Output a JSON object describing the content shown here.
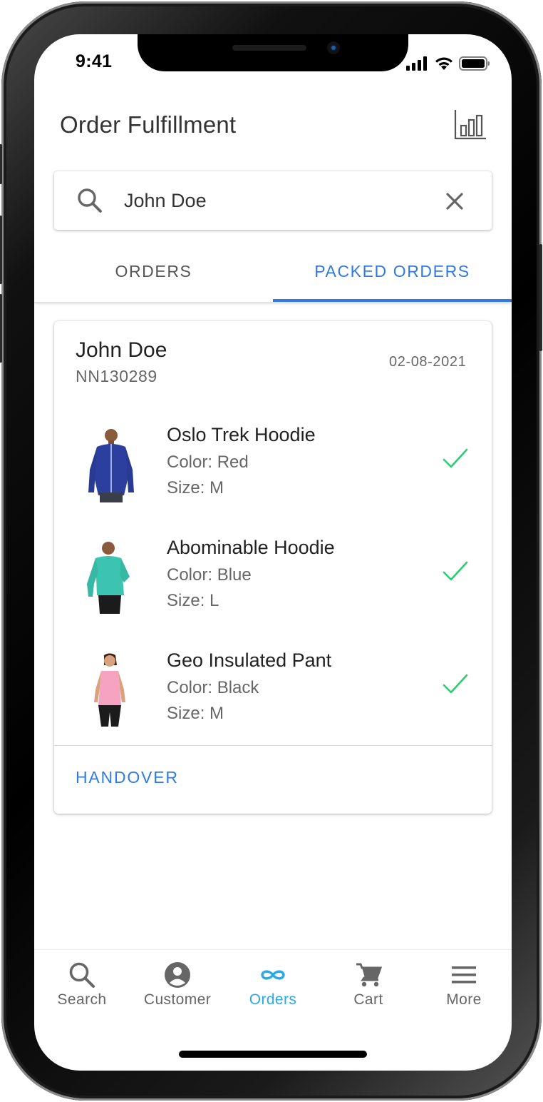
{
  "status_bar": {
    "time": "9:41"
  },
  "header": {
    "title": "Order Fulfillment",
    "chart_icon": "bar-chart-icon"
  },
  "search": {
    "value": "John Doe",
    "placeholder": "Search",
    "icon": "search-icon",
    "clear_icon": "close-icon"
  },
  "tabs": [
    {
      "label": "ORDERS",
      "active": false
    },
    {
      "label": "PACKED ORDERS",
      "active": true
    }
  ],
  "order": {
    "customer_name": "John Doe",
    "order_id": "NN130289",
    "date": "02-08-2021",
    "items": [
      {
        "name": "Oslo Trek Hoodie",
        "color": "Color: Red",
        "size": "Size: M",
        "packed": true
      },
      {
        "name": "Abominable Hoodie",
        "color": "Color: Blue",
        "size": "Size: L",
        "packed": true
      },
      {
        "name": "Geo Insulated Pant",
        "color": "Color: Black",
        "size": "Size: M",
        "packed": true
      }
    ],
    "action_label": "HANDOVER"
  },
  "bottom_nav": [
    {
      "label": "Search",
      "icon": "search-icon",
      "active": false
    },
    {
      "label": "Customer",
      "icon": "account-circle-icon",
      "active": false
    },
    {
      "label": "Orders",
      "icon": "infinity-icon",
      "active": true
    },
    {
      "label": "Cart",
      "icon": "cart-icon",
      "active": false
    },
    {
      "label": "More",
      "icon": "menu-icon",
      "active": false
    }
  ],
  "colors": {
    "accent": "#2f7ae5",
    "nav_active": "#2aa8ea",
    "check": "#2ecc71",
    "text": "#222222"
  }
}
